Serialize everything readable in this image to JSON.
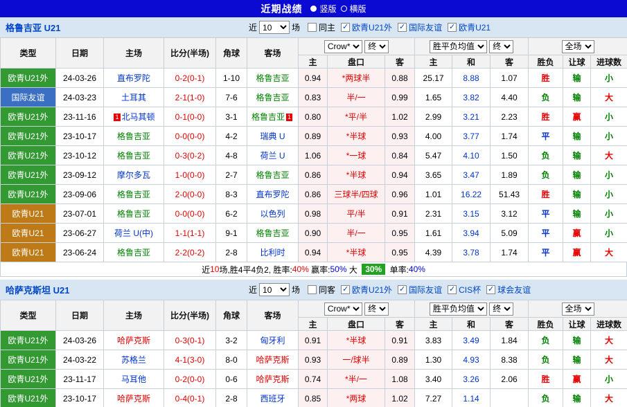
{
  "colors": {
    "topbar_blue": "#0a0ad2",
    "section_header_blue": "#d8e6f3",
    "league_green": "#339933",
    "league_blue": "#3a6fc4",
    "league_orange": "#bd7a16",
    "win_red": "#e60000",
    "lose_green": "#008000",
    "draw_blue": "#0033cc",
    "summary_badge_green": "#21a321",
    "odds_column_pink": "#fdf0f0"
  },
  "topbar": {
    "title": "近期战绩",
    "view_options": [
      {
        "label": "竖版",
        "selected": true
      },
      {
        "label": "横版",
        "selected": false
      }
    ]
  },
  "table_header": {
    "type": "类型",
    "date": "日期",
    "home": "主场",
    "score": "比分(半场)",
    "corner": "角球",
    "away": "客场",
    "asia_book_select": "Crow*",
    "asia_final_select": "终",
    "asia_cols": [
      "主",
      "盘口",
      "客"
    ],
    "europe_select": "胜平负均值",
    "europe_final_select": "终",
    "europe_cols": [
      "主",
      "和",
      "客"
    ],
    "result_select": "全场",
    "result_cols": [
      "胜负",
      "让球",
      "进球数"
    ]
  },
  "sections": [
    {
      "team": "格鲁吉亚 U21",
      "filters": {
        "near": "近",
        "count": "10",
        "games": "场",
        "same_side": {
          "label": "同主",
          "checked": false
        },
        "leagues": [
          {
            "label": "欧青U21外",
            "checked": true
          },
          {
            "label": "国际友谊",
            "checked": true
          },
          {
            "label": "欧青U21",
            "checked": true
          }
        ]
      },
      "rows": [
        {
          "type": "欧青U21外",
          "type_color": "green",
          "date": "24-03-26",
          "home": {
            "name": "直布罗陀",
            "color": "blue",
            "badge": ""
          },
          "score": "0-2(0-1)",
          "corner": "1-10",
          "away": {
            "name": "格鲁吉亚",
            "color": "green",
            "badge": ""
          },
          "asia": [
            "0.94",
            "*两球半",
            "0.88"
          ],
          "europe": [
            "25.17",
            "8.88",
            "1.07"
          ],
          "result": [
            [
              "胜",
              "red"
            ],
            [
              "输",
              "green"
            ],
            [
              "小",
              "green"
            ]
          ]
        },
        {
          "type": "国际友谊",
          "type_color": "blue",
          "date": "24-03-23",
          "home": {
            "name": "土耳其",
            "color": "blue",
            "badge": ""
          },
          "score": "2-1(1-0)",
          "corner": "7-6",
          "away": {
            "name": "格鲁吉亚",
            "color": "green",
            "badge": ""
          },
          "asia": [
            "0.83",
            "半/一",
            "0.99"
          ],
          "europe": [
            "1.65",
            "3.82",
            "4.40"
          ],
          "result": [
            [
              "负",
              "green"
            ],
            [
              "输",
              "green"
            ],
            [
              "大",
              "red"
            ]
          ]
        },
        {
          "type": "欧青U21外",
          "type_color": "green",
          "date": "23-11-16",
          "home": {
            "name": "北马其顿",
            "color": "blue",
            "badge": "1"
          },
          "score": "0-1(0-0)",
          "corner": "3-1",
          "away": {
            "name": "格鲁吉亚",
            "color": "green",
            "badge": "1"
          },
          "asia": [
            "0.80",
            "*平/半",
            "1.02"
          ],
          "europe": [
            "2.99",
            "3.21",
            "2.23"
          ],
          "result": [
            [
              "胜",
              "red"
            ],
            [
              "赢",
              "red"
            ],
            [
              "小",
              "green"
            ]
          ]
        },
        {
          "type": "欧青U21外",
          "type_color": "green",
          "date": "23-10-17",
          "home": {
            "name": "格鲁吉亚",
            "color": "green",
            "badge": ""
          },
          "score": "0-0(0-0)",
          "corner": "4-2",
          "away": {
            "name": "瑞典 U",
            "color": "blue",
            "badge": ""
          },
          "asia": [
            "0.89",
            "*半球",
            "0.93"
          ],
          "europe": [
            "4.00",
            "3.77",
            "1.74"
          ],
          "result": [
            [
              "平",
              "blue"
            ],
            [
              "输",
              "green"
            ],
            [
              "小",
              "green"
            ]
          ]
        },
        {
          "type": "欧青U21外",
          "type_color": "green",
          "date": "23-10-12",
          "home": {
            "name": "格鲁吉亚",
            "color": "green",
            "badge": ""
          },
          "score": "0-3(0-2)",
          "corner": "4-8",
          "away": {
            "name": "荷兰 U",
            "color": "blue",
            "badge": ""
          },
          "asia": [
            "1.06",
            "*一球",
            "0.84"
          ],
          "europe": [
            "5.47",
            "4.10",
            "1.50"
          ],
          "result": [
            [
              "负",
              "green"
            ],
            [
              "输",
              "green"
            ],
            [
              "大",
              "red"
            ]
          ]
        },
        {
          "type": "欧青U21外",
          "type_color": "green",
          "date": "23-09-12",
          "home": {
            "name": "摩尔多瓦",
            "color": "blue",
            "badge": ""
          },
          "score": "1-0(0-0)",
          "corner": "2-7",
          "away": {
            "name": "格鲁吉亚",
            "color": "green",
            "badge": ""
          },
          "asia": [
            "0.86",
            "*半球",
            "0.94"
          ],
          "europe": [
            "3.65",
            "3.47",
            "1.89"
          ],
          "result": [
            [
              "负",
              "green"
            ],
            [
              "输",
              "green"
            ],
            [
              "小",
              "green"
            ]
          ]
        },
        {
          "type": "欧青U21外",
          "type_color": "green",
          "date": "23-09-06",
          "home": {
            "name": "格鲁吉亚",
            "color": "green",
            "badge": ""
          },
          "score": "2-0(0-0)",
          "corner": "8-3",
          "away": {
            "name": "直布罗陀",
            "color": "blue",
            "badge": ""
          },
          "asia": [
            "0.86",
            "三球半/四球",
            "0.96"
          ],
          "europe": [
            "1.01",
            "16.22",
            "51.43"
          ],
          "result": [
            [
              "胜",
              "red"
            ],
            [
              "输",
              "green"
            ],
            [
              "小",
              "green"
            ]
          ]
        },
        {
          "type": "欧青U21",
          "type_color": "orange",
          "date": "23-07-01",
          "home": {
            "name": "格鲁吉亚",
            "color": "green",
            "badge": ""
          },
          "score": "0-0(0-0)",
          "corner": "6-2",
          "away": {
            "name": "以色列",
            "color": "blue",
            "badge": ""
          },
          "asia": [
            "0.98",
            "平/半",
            "0.91"
          ],
          "europe": [
            "2.31",
            "3.15",
            "3.12"
          ],
          "result": [
            [
              "平",
              "blue"
            ],
            [
              "输",
              "green"
            ],
            [
              "小",
              "green"
            ]
          ]
        },
        {
          "type": "欧青U21",
          "type_color": "orange",
          "date": "23-06-27",
          "home": {
            "name": "荷兰 U(中)",
            "color": "blue",
            "badge": ""
          },
          "score": "1-1(1-1)",
          "corner": "9-1",
          "away": {
            "name": "格鲁吉亚",
            "color": "green",
            "badge": ""
          },
          "asia": [
            "0.90",
            "半/一",
            "0.95"
          ],
          "europe": [
            "1.61",
            "3.94",
            "5.09"
          ],
          "result": [
            [
              "平",
              "blue"
            ],
            [
              "赢",
              "red"
            ],
            [
              "小",
              "green"
            ]
          ]
        },
        {
          "type": "欧青U21",
          "type_color": "orange",
          "date": "23-06-24",
          "home": {
            "name": "格鲁吉亚",
            "color": "green",
            "badge": ""
          },
          "score": "2-2(0-2)",
          "corner": "2-8",
          "away": {
            "name": "比利时",
            "color": "blue",
            "badge": ""
          },
          "asia": [
            "0.94",
            "*半球",
            "0.95"
          ],
          "europe": [
            "4.39",
            "3.78",
            "1.74"
          ],
          "result": [
            [
              "平",
              "blue"
            ],
            [
              "赢",
              "red"
            ],
            [
              "大",
              "red"
            ]
          ]
        }
      ],
      "summary": [
        {
          "text": "近",
          "style": "plain"
        },
        {
          "text": "10",
          "style": "red"
        },
        {
          "text": "场,胜4平4负2, 胜率:",
          "style": "plain"
        },
        {
          "text": "40%",
          "style": "red"
        },
        {
          "text": " 赢率:",
          "style": "plain"
        },
        {
          "text": "50%",
          "style": "blue"
        },
        {
          "text": " 大 ",
          "style": "plain"
        },
        {
          "text": "30%",
          "style": "badge"
        },
        {
          "text": " 单率:",
          "style": "plain"
        },
        {
          "text": "40%",
          "style": "blue"
        }
      ]
    },
    {
      "team": "哈萨克斯坦 U21",
      "filters": {
        "near": "近",
        "count": "10",
        "games": "场",
        "same_side": {
          "label": "同客",
          "checked": false
        },
        "leagues": [
          {
            "label": "欧青U21外",
            "checked": true
          },
          {
            "label": "国际友谊",
            "checked": true
          },
          {
            "label": "CIS杯",
            "checked": true
          },
          {
            "label": "球会友谊",
            "checked": true
          }
        ]
      },
      "rows": [
        {
          "type": "欧青U21外",
          "type_color": "green",
          "date": "24-03-26",
          "home": {
            "name": "哈萨克斯",
            "color": "red",
            "badge": ""
          },
          "score": "0-3(0-1)",
          "corner": "3-2",
          "away": {
            "name": "匈牙利",
            "color": "blue",
            "badge": ""
          },
          "asia": [
            "0.91",
            "*半球",
            "0.91"
          ],
          "europe": [
            "3.83",
            "3.49",
            "1.84"
          ],
          "result": [
            [
              "负",
              "green"
            ],
            [
              "输",
              "green"
            ],
            [
              "大",
              "red"
            ]
          ]
        },
        {
          "type": "欧青U21外",
          "type_color": "green",
          "date": "24-03-22",
          "home": {
            "name": "苏格兰",
            "color": "blue",
            "badge": ""
          },
          "score": "4-1(3-0)",
          "corner": "8-0",
          "away": {
            "name": "哈萨克斯",
            "color": "red",
            "badge": ""
          },
          "asia": [
            "0.93",
            "一/球半",
            "0.89"
          ],
          "europe": [
            "1.30",
            "4.93",
            "8.38"
          ],
          "result": [
            [
              "负",
              "green"
            ],
            [
              "输",
              "green"
            ],
            [
              "大",
              "red"
            ]
          ]
        },
        {
          "type": "欧青U21外",
          "type_color": "green",
          "date": "23-11-17",
          "home": {
            "name": "马耳他",
            "color": "blue",
            "badge": ""
          },
          "score": "0-2(0-0)",
          "corner": "0-6",
          "away": {
            "name": "哈萨克斯",
            "color": "red",
            "badge": ""
          },
          "asia": [
            "0.74",
            "*半/一",
            "1.08"
          ],
          "europe": [
            "3.40",
            "3.26",
            "2.06"
          ],
          "result": [
            [
              "胜",
              "red"
            ],
            [
              "赢",
              "red"
            ],
            [
              "小",
              "green"
            ]
          ]
        },
        {
          "type": "欧青U21外",
          "type_color": "green",
          "date": "23-10-17",
          "home": {
            "name": "哈萨克斯",
            "color": "red",
            "badge": ""
          },
          "score": "0-4(0-1)",
          "corner": "2-8",
          "away": {
            "name": "西班牙",
            "color": "blue",
            "badge": ""
          },
          "asia": [
            "0.85",
            "*两球",
            "1.02"
          ],
          "europe": [
            "7.27",
            "1.14",
            ""
          ],
          "result": [
            [
              "负",
              "green"
            ],
            [
              "输",
              "green"
            ],
            [
              "大",
              "red"
            ]
          ]
        }
      ]
    }
  ]
}
